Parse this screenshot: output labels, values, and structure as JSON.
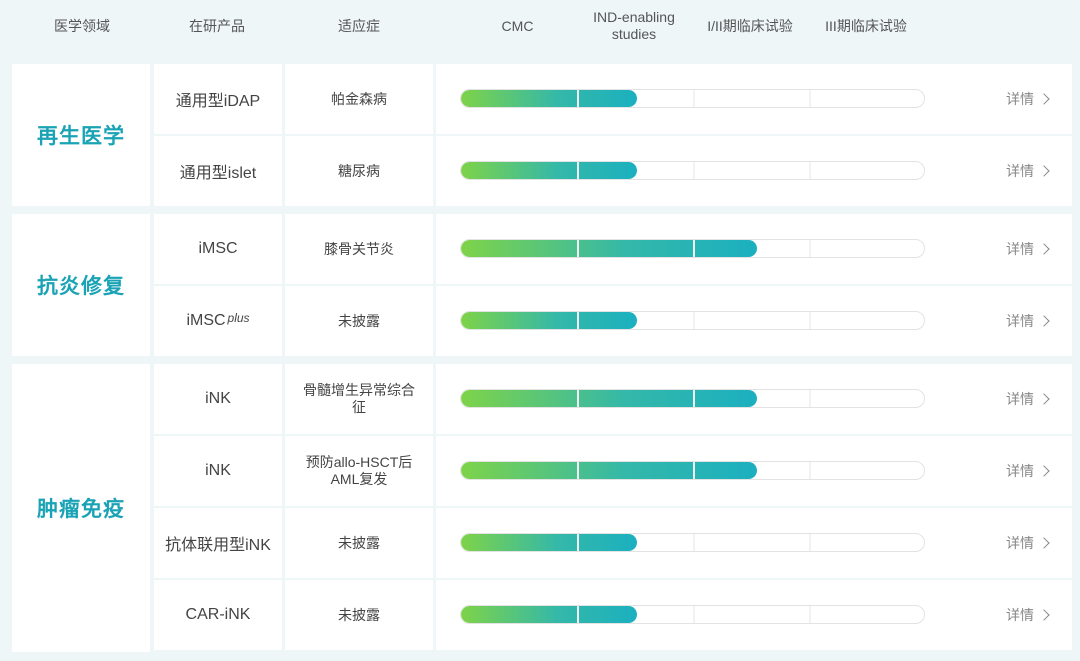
{
  "header": {
    "domain": "医学领域",
    "product": "在研产品",
    "indication": "适应症",
    "stage1": "CMC",
    "stage2": "IND-enabling studies",
    "stage3": "I/II期临床试验",
    "stage4": "III期临床试验"
  },
  "detail_label": "详情",
  "colors": {
    "domain_text": "#1aa3b5",
    "fill_start": "#7ed348",
    "fill_end": "#1bb0c0",
    "background": "#eef6f8"
  },
  "groups": [
    {
      "domain": "再生医学",
      "rows": [
        {
          "product": "通用型iDAP",
          "indication": "帕金森病",
          "progress_fraction": 0.38
        },
        {
          "product": "通用型islet",
          "indication": "糖尿病",
          "progress_fraction": 0.38
        }
      ]
    },
    {
      "domain": "抗炎修复",
      "rows": [
        {
          "product": "iMSC",
          "indication": "膝骨关节炎",
          "progress_fraction": 0.64
        },
        {
          "product": "iMSC",
          "product_sup": "plus",
          "indication": "未披露",
          "progress_fraction": 0.38
        }
      ]
    },
    {
      "domain": "肿瘤免疫",
      "rows": [
        {
          "product": "iNK",
          "indication": "骨髓增生异常综合征",
          "progress_fraction": 0.64
        },
        {
          "product": "iNK",
          "indication": "预防allo-HSCT后AML复发",
          "progress_fraction": 0.64
        },
        {
          "product": "抗体联用型iNK",
          "indication": "未披露",
          "progress_fraction": 0.38
        },
        {
          "product": "CAR-iNK",
          "indication": "未披露",
          "progress_fraction": 0.38
        }
      ]
    }
  ]
}
